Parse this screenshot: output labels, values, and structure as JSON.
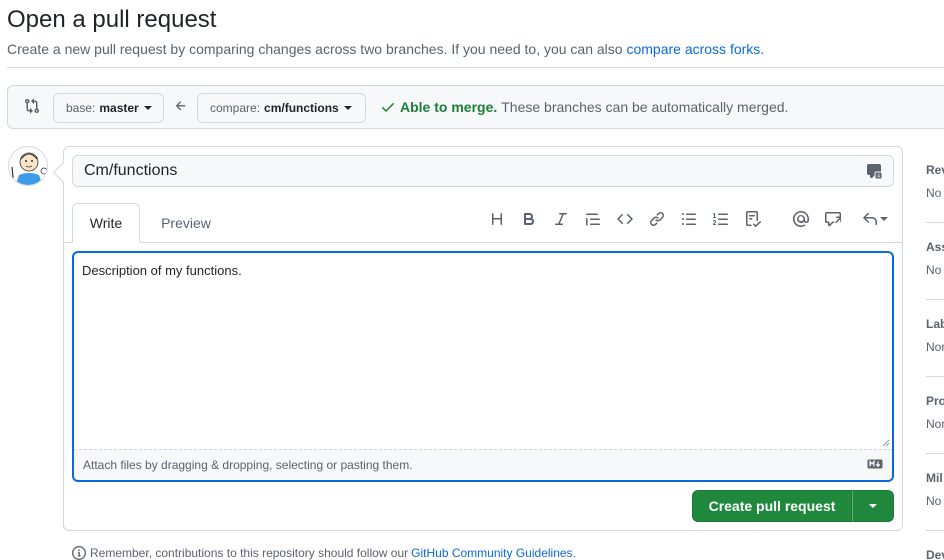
{
  "header": {
    "title": "Open a pull request",
    "subtitle": "Create a new pull request by comparing changes across two branches. If you need to, you can also",
    "subtitle_link": "compare across forks",
    "subtitle_end": "."
  },
  "compare": {
    "base_prefix": "base:",
    "base_branch": "master",
    "compare_prefix": "compare:",
    "compare_branch": "cm/functions",
    "merge_status_bold": "Able to merge.",
    "merge_status_rest": "These branches can be automatically merged."
  },
  "form": {
    "title_value": "Cm/functions",
    "tabs": [
      {
        "label": "Write",
        "active": true
      },
      {
        "label": "Preview",
        "active": false
      }
    ],
    "toolbar_icons": [
      "heading-icon",
      "bold-icon",
      "italic-icon",
      "quote-icon",
      "code-icon",
      "link-icon",
      "unordered-list-icon",
      "ordered-list-icon",
      "task-list-icon",
      "mention-icon",
      "reference-icon",
      "reply-icon"
    ],
    "body_value": "Description of my functions.",
    "attach_hint": "Attach files by dragging & dropping, selecting or pasting them.",
    "submit_label": "Create pull request"
  },
  "footnote": {
    "text": "Remember, contributions to this repository should follow our",
    "link": "GitHub Community Guidelines",
    "end": "."
  },
  "sidebar": [
    {
      "heading": "Rev",
      "value": "No"
    },
    {
      "heading": "Ass",
      "value": "No"
    },
    {
      "heading": "Lab",
      "value": "Nor"
    },
    {
      "heading": "Pro",
      "value": "Nor"
    },
    {
      "heading": "Mil",
      "value": "No"
    },
    {
      "heading": "Dev",
      "value": ""
    }
  ],
  "colors": {
    "link": "#0969da",
    "success": "#1a7f37",
    "primary_button": "#1f883d",
    "focus_border": "#0969da"
  }
}
